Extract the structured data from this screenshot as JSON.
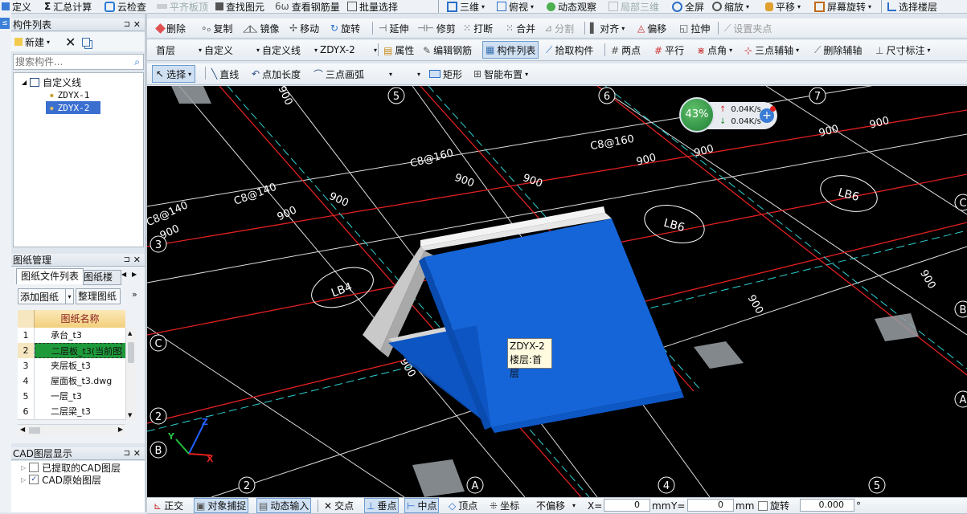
{
  "menu": {
    "items": [
      {
        "label": "定义",
        "icon": "define-icon"
      },
      {
        "label": "汇总计算",
        "icon": "sigma-icon",
        "prefix": "Σ"
      },
      {
        "label": "云检查",
        "icon": "cloud-check-icon"
      },
      {
        "label": "平齐板顶",
        "icon": "align-slab-icon",
        "disabled": true
      },
      {
        "label": "查找图元",
        "icon": "find-icon"
      },
      {
        "label": "查看钢筋量",
        "icon": "rebar-qty-icon"
      },
      {
        "label": "批量选择",
        "icon": "batch-select-icon"
      },
      {
        "label": "三维",
        "icon": "3d-icon"
      },
      {
        "label": "俯视",
        "icon": "top-view-icon"
      },
      {
        "label": "动态观察",
        "icon": "orbit-icon"
      },
      {
        "label": "局部三维",
        "icon": "local-3d-icon",
        "disabled": true
      },
      {
        "label": "全屏",
        "icon": "fullscreen-icon"
      },
      {
        "label": "缩放",
        "icon": "zoom-icon"
      },
      {
        "label": "平移",
        "icon": "pan-icon"
      },
      {
        "label": "屏幕旋转",
        "icon": "rotate-screen-icon"
      },
      {
        "label": "选择楼层",
        "icon": "floor-select-icon"
      }
    ]
  },
  "edit_toolbar": {
    "items": [
      "删除",
      "复制",
      "镜像",
      "移动",
      "旋转",
      "延伸",
      "修剪",
      "打断",
      "合并",
      "分割",
      "对齐",
      "偏移",
      "拉伸",
      "设置夹点"
    ]
  },
  "prop_toolbar": {
    "floor": "首层",
    "category": "自定义",
    "type": "自定义线",
    "component": "ZDYX-2",
    "buttons": [
      "属性",
      "编辑钢筋",
      "构件列表",
      "拾取构件",
      "两点",
      "平行",
      "点角",
      "三点辅轴",
      "删除辅轴",
      "尺寸标注"
    ]
  },
  "draw_toolbar": {
    "select": "选择",
    "line": "直线",
    "point_length": "点加长度",
    "arc": "三点画弧",
    "rect": "矩形",
    "smart": "智能布置"
  },
  "component_panel": {
    "title": "构件列表",
    "new_label": "新建",
    "search_placeholder": "搜索构件...",
    "tree_root": "自定义线",
    "items": [
      "ZDYX-1",
      "ZDYX-2"
    ],
    "selected": "ZDYX-2"
  },
  "drawing_panel": {
    "title": "图纸管理",
    "tabs": [
      "图纸文件列表",
      "图纸楼"
    ],
    "add_label": "添加图纸",
    "organize_label": "整理图纸",
    "column_header": "图纸名称",
    "rows": [
      {
        "n": "1",
        "name": "承台_t3"
      },
      {
        "n": "2",
        "name": "二层板_t3(当前图"
      },
      {
        "n": "3",
        "name": "夹层板_t3"
      },
      {
        "n": "4",
        "name": "屋面板_t3.dwg"
      },
      {
        "n": "5",
        "name": "一层_t3"
      },
      {
        "n": "6",
        "name": "二层梁_t3"
      }
    ],
    "active_row": 1
  },
  "cad_panel": {
    "title": "CAD图层显示",
    "layers": [
      {
        "label": "已提取的CAD图层",
        "checked": false
      },
      {
        "label": "CAD原始图层",
        "checked": true
      }
    ]
  },
  "viewport": {
    "tooltip_name": "ZDYX-2",
    "tooltip_floor": "楼层:首层",
    "net_percent": "43%",
    "upload": "0.04K/s",
    "download": "0.04K/s",
    "labels": {
      "slab_labels": [
        "LB4",
        "LB6",
        "LB6"
      ],
      "rebar_labels": [
        "C8@140",
        "C8@140",
        "C8@160",
        "C8@160"
      ],
      "dim_900": "900",
      "axis_numbers": [
        "5",
        "6",
        "7",
        "3",
        "2",
        "4",
        "5",
        "2"
      ],
      "axis_letters": [
        "C",
        "B",
        "A",
        "C",
        "B",
        "A"
      ]
    },
    "colors": {
      "background": "#000000",
      "component": "#1565d8",
      "component_top": "#e0e0e0"
    }
  },
  "status_bar": {
    "items": [
      "正交",
      "对象捕捉",
      "动态输入",
      "交点",
      "垂点",
      "中点",
      "顶点",
      "坐标"
    ],
    "offset_mode": "不偏移",
    "x_label": "X=",
    "x_value": "0",
    "y_label": "Y=",
    "y_value": "0",
    "unit": "mm",
    "rotate_label": "旋转",
    "rotate_value": "0.000"
  }
}
